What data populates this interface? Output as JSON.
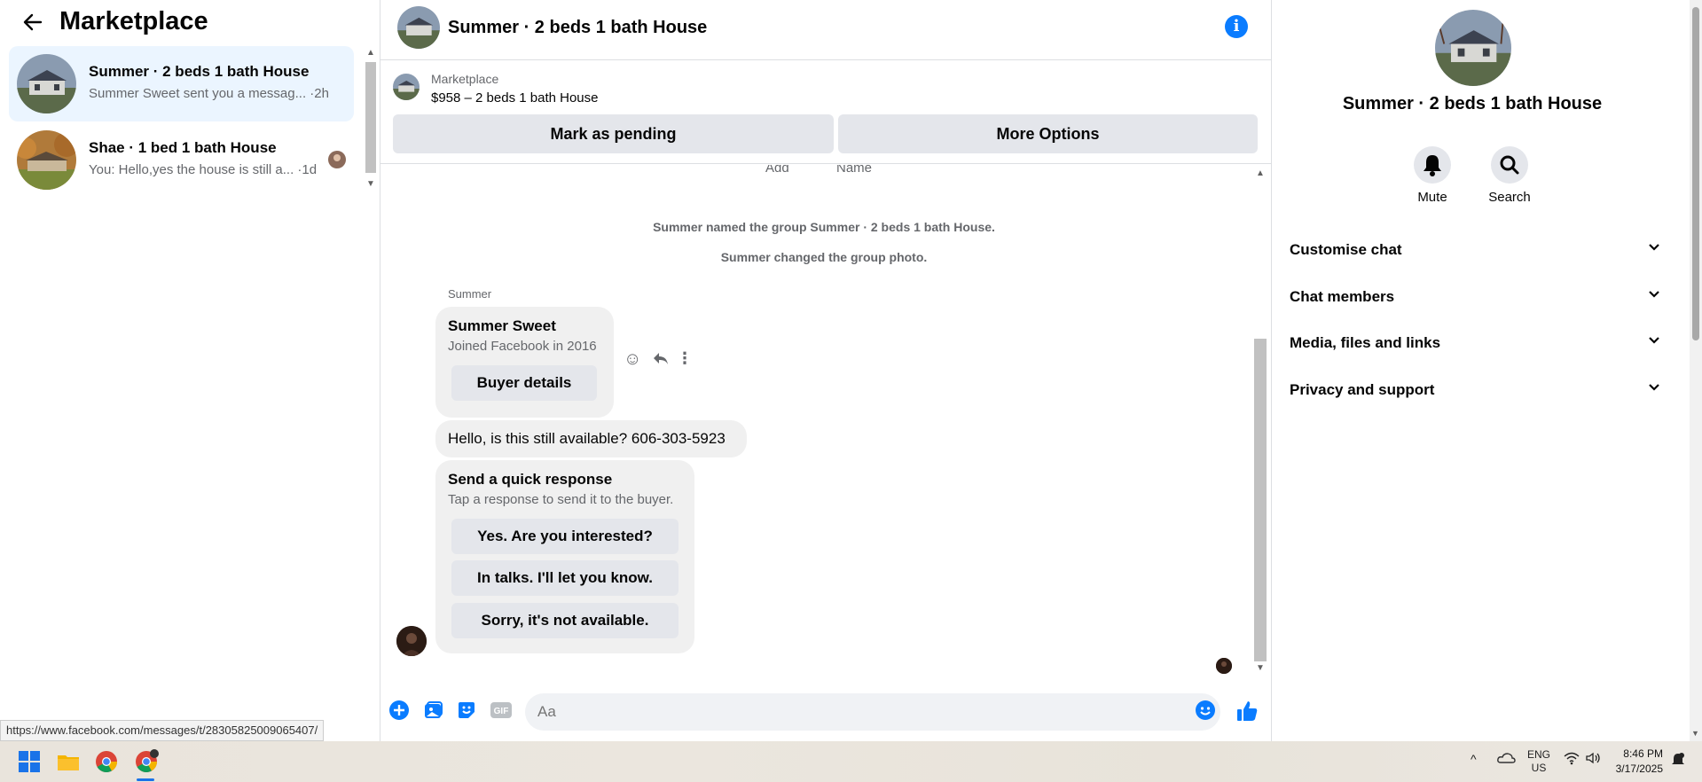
{
  "sidebar": {
    "title": "Marketplace",
    "conversations": [
      {
        "name": "Summer · 2 beds 1 bath House",
        "snippet": "Summer Sweet sent you a messag...",
        "time": "·2h"
      },
      {
        "name": "Shae · 1 bed 1 bath House",
        "snippet": "You: Hello,yes the house is still a...",
        "time": "·1d"
      }
    ]
  },
  "chat": {
    "title": "Summer · 2 beds 1 bath House",
    "marketplace_label": "Marketplace",
    "listing": "$958 – 2 beds 1 bath House",
    "mark_pending": "Mark as pending",
    "more_options": "More Options",
    "cut_left": "Add",
    "cut_right": "Name",
    "system_messages": [
      "Summer named the group Summer · 2 beds 1 bath House.",
      "Summer changed the group photo."
    ],
    "sender_name": "Summer",
    "profile_card": {
      "name": "Summer Sweet",
      "joined": "Joined Facebook in 2016",
      "button": "Buyer details"
    },
    "message": "Hello, is this still available? 606-303-5923",
    "quick_response": {
      "title": "Send a quick response",
      "subtitle": "Tap a response to send it to the buyer.",
      "options": [
        "Yes. Are you interested?",
        "In talks. I'll let you know.",
        "Sorry, it's not available."
      ]
    },
    "composer_placeholder": "Aa"
  },
  "details": {
    "title": "Summer · 2 beds 1 bath House",
    "actions": [
      "Mute",
      "Search"
    ],
    "sections": [
      "Customise chat",
      "Chat members",
      "Media, files and links",
      "Privacy and support"
    ]
  },
  "status_url": "https://www.facebook.com/messages/t/28305825009065407/",
  "taskbar": {
    "lang_top": "ENG",
    "lang_bottom": "US",
    "time": "8:46 PM",
    "date": "3/17/2025"
  },
  "colors": {
    "accent": "#0a7cff",
    "active_conv": "#ebf5ff"
  }
}
